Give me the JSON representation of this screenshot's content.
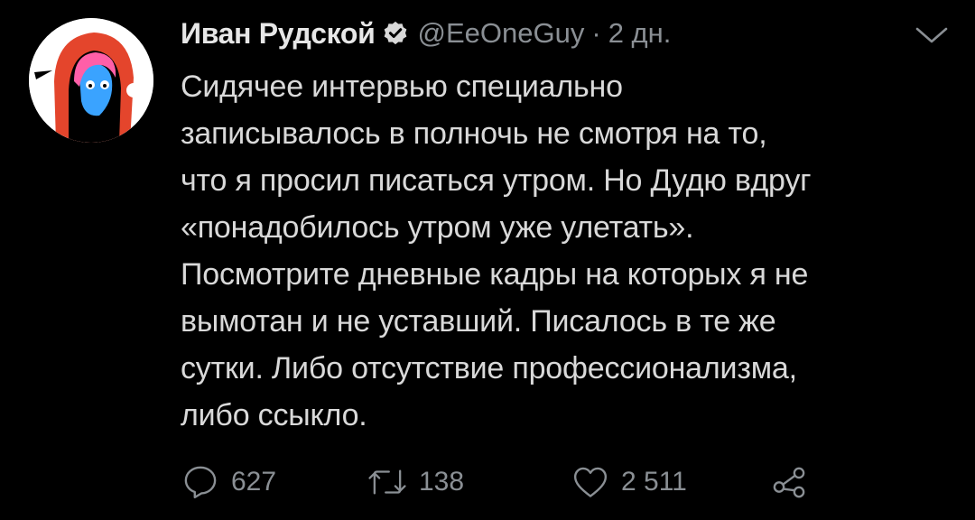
{
  "tweet": {
    "author": {
      "display_name": "Иван Рудской",
      "handle": "@EeOneGuy",
      "verified": true,
      "avatar_icon": "avatar-red-hoodie-icon"
    },
    "separator": "·",
    "time": "2 дн.",
    "text_lines": [
      "Сидячее интервью специально",
      "записывалось в полночь не смотря на то,",
      "что я просил писаться утром. Но Дудю вдруг",
      "«понадобилось утром уже улетать».",
      "Посмотрите дневные кадры на которых я не",
      "вымотан и не уставший. Писалось в те же",
      "сутки. Либо отсутствие профессионализма,",
      "либо ссыкло."
    ],
    "actions": {
      "reply": {
        "icon": "reply-icon",
        "count": "627"
      },
      "retweet": {
        "icon": "retweet-icon",
        "count": "138"
      },
      "like": {
        "icon": "heart-icon",
        "count": "2 511"
      },
      "share": {
        "icon": "share-icon"
      }
    },
    "menu_icon": "chevron-down-icon"
  },
  "colors": {
    "background": "#000000",
    "text": "#d9d9d9",
    "secondary": "#8a8f94",
    "verified_badge": "#d9d9d9"
  }
}
